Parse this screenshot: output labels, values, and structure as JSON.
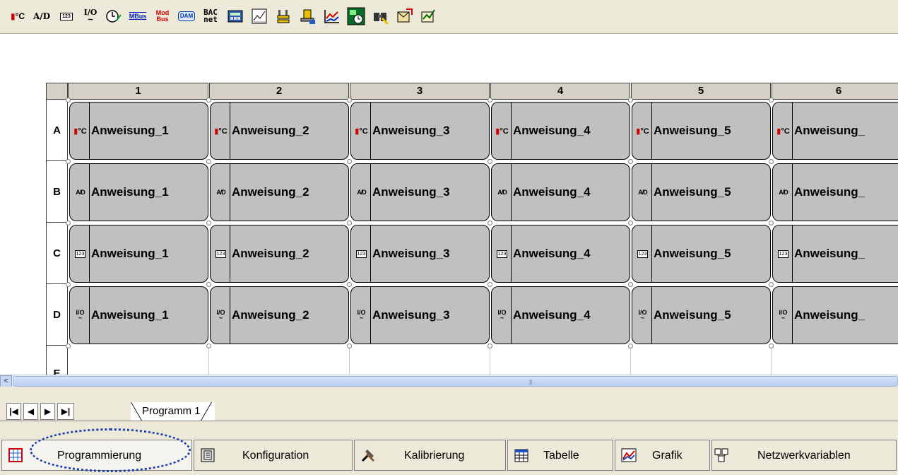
{
  "toolbar": {
    "buttons": [
      {
        "name": "temperature-tool",
        "label": "°C"
      },
      {
        "name": "analog-digital-tool",
        "label": "A/D"
      },
      {
        "name": "counter-tool",
        "label": "123"
      },
      {
        "name": "io-tool",
        "label_top": "I/O",
        "label_bottom": "~"
      },
      {
        "name": "timer-tool",
        "label": "⏲"
      },
      {
        "name": "mbus-tool",
        "label": "MBus"
      },
      {
        "name": "modbus-tool",
        "label_top": "Mod",
        "label_bottom": "Bus"
      },
      {
        "name": "dam-tool",
        "label": "DAM"
      },
      {
        "name": "bacnet-tool",
        "label_top": "BAC",
        "label_bottom": "net"
      },
      {
        "name": "display-tool",
        "label": ""
      },
      {
        "name": "chart-tool",
        "label": ""
      },
      {
        "name": "link-tool",
        "label": ""
      },
      {
        "name": "tap-tool",
        "label": ""
      },
      {
        "name": "graph-tool",
        "label": ""
      },
      {
        "name": "scheduler-tool",
        "label": ""
      },
      {
        "name": "search-tool",
        "label": ""
      },
      {
        "name": "export-tool",
        "label": ""
      },
      {
        "name": "report-tool",
        "label": ""
      }
    ]
  },
  "grid": {
    "columns": [
      "1",
      "2",
      "3",
      "4",
      "5",
      "6"
    ],
    "rows": [
      {
        "label": "A",
        "icon": "temperature",
        "icon_text": "°C",
        "cells": [
          "Anweisung_1",
          "Anweisung_2",
          "Anweisung_3",
          "Anweisung_4",
          "Anweisung_5",
          "Anweisung_"
        ]
      },
      {
        "label": "B",
        "icon": "analog-digital",
        "icon_text": "A/D",
        "cells": [
          "Anweisung_1",
          "Anweisung_2",
          "Anweisung_3",
          "Anweisung_4",
          "Anweisung_5",
          "Anweisung_"
        ]
      },
      {
        "label": "C",
        "icon": "counter",
        "icon_text": "123",
        "cells": [
          "Anweisung_1",
          "Anweisung_2",
          "Anweisung_3",
          "Anweisung_4",
          "Anweisung_5",
          "Anweisung_"
        ]
      },
      {
        "label": "D",
        "icon": "io",
        "icon_text": "I/O",
        "cells": [
          "Anweisung_1",
          "Anweisung_2",
          "Anweisung_3",
          "Anweisung_4",
          "Anweisung_5",
          "Anweisung_"
        ]
      }
    ],
    "partial_row_label": "E"
  },
  "scrollbar": {
    "left_arrow": "<",
    "grip": "|||"
  },
  "program_tabs": {
    "nav": [
      "|◀",
      "◀",
      "▶",
      "▶|"
    ],
    "tabs": [
      "Programm 1"
    ]
  },
  "bottom_tabs": [
    {
      "name": "programmierung",
      "label": "Programmierung",
      "icon": "grid-icon",
      "active": true
    },
    {
      "name": "konfiguration",
      "label": "Konfiguration",
      "icon": "config-icon"
    },
    {
      "name": "kalibrierung",
      "label": "Kalibrierung",
      "icon": "tools-icon"
    },
    {
      "name": "tabelle",
      "label": "Tabelle",
      "icon": "table-icon"
    },
    {
      "name": "grafik",
      "label": "Grafik",
      "icon": "graph-icon"
    },
    {
      "name": "netzwerkvariablen",
      "label": "Netzwerkvariablen",
      "icon": "network-icon"
    }
  ],
  "colors": {
    "cell_fill": "#c0c0c0",
    "header_fill": "#d4d0c8",
    "focus_ring": "#1b3fb0",
    "toolbar_bg": "#ece9d8"
  }
}
